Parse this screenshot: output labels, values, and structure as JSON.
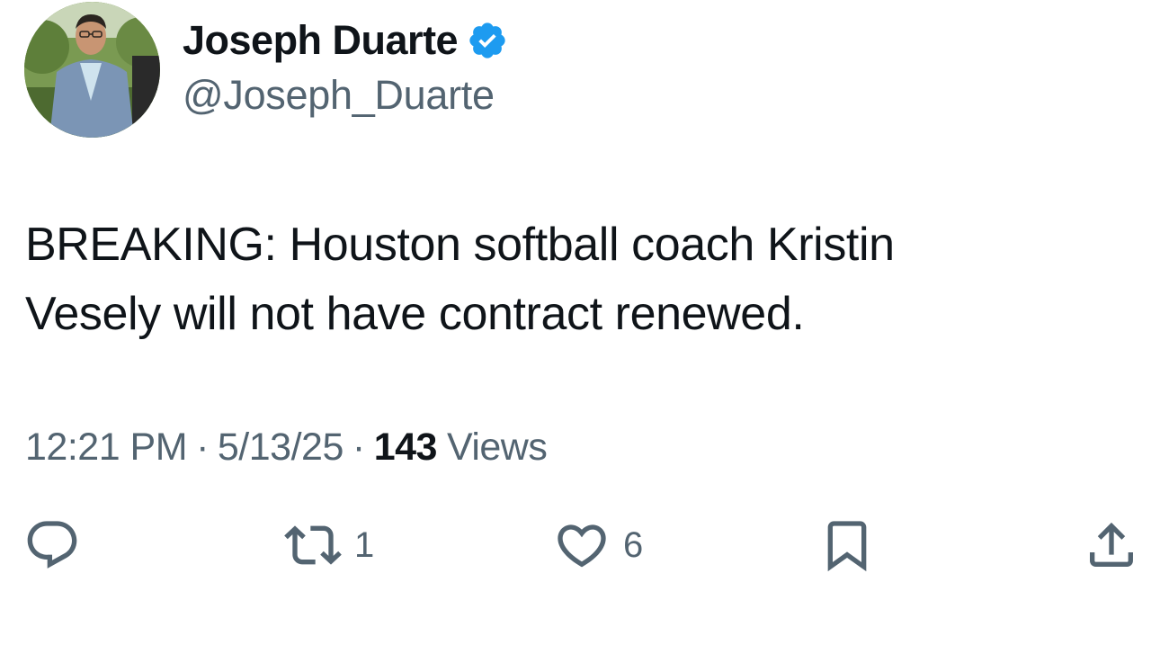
{
  "author": {
    "display_name": "Joseph Duarte",
    "handle": "@Joseph_Duarte",
    "verified": true,
    "verified_color": "#1d9bf0",
    "avatar_icon": "profile-photo"
  },
  "tweet": {
    "text_lines": [
      "BREAKING: Houston softball coach Kristin",
      "Vesely will not have contract renewed."
    ]
  },
  "meta": {
    "time": "12:21 PM",
    "date": "5/13/25",
    "views_count": "143",
    "views_label": "Views"
  },
  "actions": {
    "reply": {
      "icon": "reply-icon",
      "count": ""
    },
    "retweet": {
      "icon": "retweet-icon",
      "count": "1"
    },
    "like": {
      "icon": "heart-icon",
      "count": "6"
    },
    "bookmark": {
      "icon": "bookmark-icon",
      "count": ""
    },
    "share": {
      "icon": "share-icon",
      "count": ""
    }
  },
  "colors": {
    "text_primary": "#0f1419",
    "text_secondary": "#536471",
    "accent": "#1d9bf0"
  }
}
